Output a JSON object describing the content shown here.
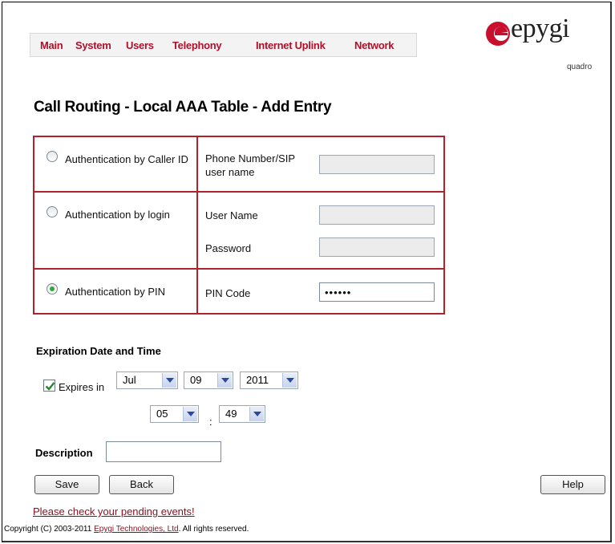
{
  "nav": {
    "items": [
      {
        "label": "Main"
      },
      {
        "label": "System"
      },
      {
        "label": "Users"
      },
      {
        "label": "Telephony"
      },
      {
        "label": "Internet Uplink"
      },
      {
        "label": "Network"
      }
    ]
  },
  "logo": {
    "brand": "epygi",
    "product": "quadro",
    "accent_color": "#c8102e"
  },
  "page_title": "Call Routing - Local AAA Table - Add Entry",
  "auth": {
    "caller_id": {
      "option_label": "Authentication by Caller ID",
      "field_label": "Phone Number/SIP user name",
      "value": "",
      "selected": false
    },
    "login": {
      "option_label": "Authentication by login",
      "username_label": "User Name",
      "username_value": "",
      "password_label": "Password",
      "password_value": "",
      "selected": false
    },
    "pin": {
      "option_label": "Authentication by PIN",
      "field_label": "PIN Code",
      "value": "••••••",
      "selected": true
    }
  },
  "expiration": {
    "section_title": "Expiration Date and Time",
    "expires_label": "Expires in",
    "expires_checked": true,
    "month": "Jul",
    "day": "09",
    "year": "2011",
    "hour": "05",
    "separator": ":",
    "minute": "49"
  },
  "description": {
    "label": "Description",
    "value": ""
  },
  "buttons": {
    "save": "Save",
    "back": "Back",
    "help": "Help"
  },
  "pending_link": "Please check your pending events!",
  "footer": {
    "prefix": "Copyright (C) 2003-2011 ",
    "company_link": "Epygi Technologies, Ltd",
    "suffix": ". All rights reserved."
  },
  "colors": {
    "table_border": "#b0222c",
    "nav_text": "#b0102a",
    "link": "#8a0f1e"
  }
}
